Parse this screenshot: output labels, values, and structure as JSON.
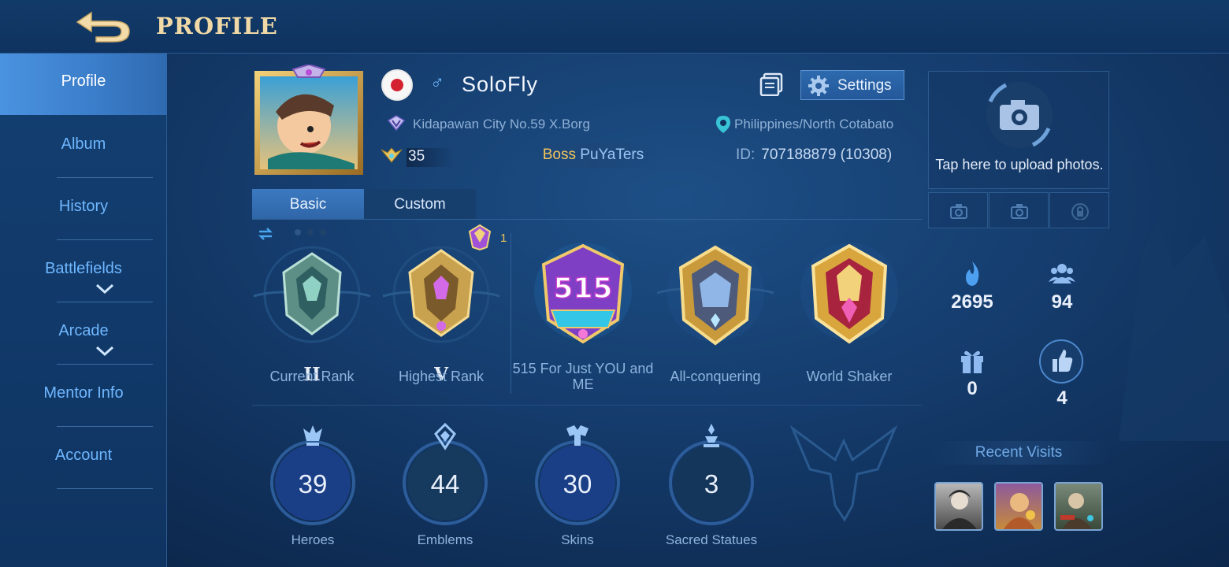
{
  "header": {
    "title": "PROFILE"
  },
  "sidebar": {
    "items": [
      {
        "label": "Profile",
        "active": true
      },
      {
        "label": "Album"
      },
      {
        "label": "History"
      },
      {
        "label": "Battlefields",
        "expandable": true
      },
      {
        "label": "Arcade",
        "expandable": true
      },
      {
        "label": "Mentor Info"
      },
      {
        "label": "Account"
      }
    ]
  },
  "profile": {
    "gender_symbol": "♂",
    "username": "SoloFly",
    "location": "Kidapawan City No.59 X.Borg",
    "level": "35",
    "squad_prefix": "Boss",
    "squad_name": "PuYaTers",
    "region": "Philippines/North Cotabato",
    "id_label": "ID:",
    "id_value": "707188879 (10308)"
  },
  "toolbar": {
    "settings_label": "Settings"
  },
  "tabs": [
    {
      "label": "Basic",
      "active": true
    },
    {
      "label": "Custom"
    }
  ],
  "badges": [
    {
      "label": "Current Rank",
      "numeral": "II"
    },
    {
      "label": "Highest Rank",
      "numeral": "V"
    },
    {
      "label": "515 For Just YOU and ME",
      "emblem_text": "515"
    },
    {
      "label": "All-conquering"
    },
    {
      "label": "World Shaker"
    }
  ],
  "highest_rank_count": "1",
  "stats": [
    {
      "label": "Heroes",
      "value": "39"
    },
    {
      "label": "Emblems",
      "value": "44"
    },
    {
      "label": "Skins",
      "value": "30"
    },
    {
      "label": "Sacred Statues",
      "value": "3"
    }
  ],
  "right_panel": {
    "upload_text": "Tap here to upload photos.",
    "popularity": "2695",
    "followers": "94",
    "gifts": "0",
    "likes": "4",
    "recent_visits_label": "Recent Visits"
  },
  "colors": {
    "accent": "#4a93e0",
    "gold": "#f0d9a6",
    "link_blue": "#6fb7ff",
    "flag_red": "#d4212f"
  }
}
